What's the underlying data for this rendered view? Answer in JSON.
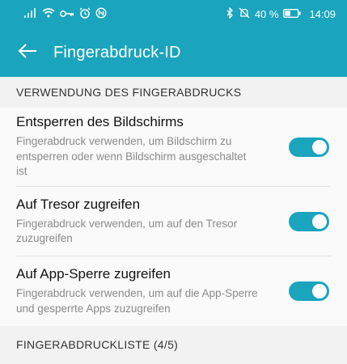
{
  "status_bar": {
    "battery_percent": "40 %",
    "time": "14:09",
    "icons_left": [
      "signal-icon",
      "wifi-icon",
      "key-icon",
      "alarm-icon",
      "nfc-icon"
    ],
    "icons_right": [
      "bluetooth-icon",
      "mute-icon"
    ]
  },
  "header": {
    "title": "Fingerabdruck-ID"
  },
  "section_usage": {
    "title": "VERWENDUNG DES FINGERABDRUCKS",
    "items": [
      {
        "title": "Entsperren des Bildschirms",
        "description": "Fingerabdruck verwenden, um Bildschirm zu entsperren oder wenn Bildschirm ausgeschaltet ist",
        "enabled": true
      },
      {
        "title": "Auf Tresor zugreifen",
        "description": "Fingerabdruck verwenden, um auf den Tresor zuzugreifen",
        "enabled": true
      },
      {
        "title": "Auf App-Sperre zugreifen",
        "description": "Fingerabdruck verwenden, um auf die App-Sperre und gesperrte Apps zuzugreifen",
        "enabled": true
      }
    ]
  },
  "section_list": {
    "title": "FINGERABDRUCKLISTE (4/5)"
  },
  "colors": {
    "accent": "#1aa4bd"
  }
}
